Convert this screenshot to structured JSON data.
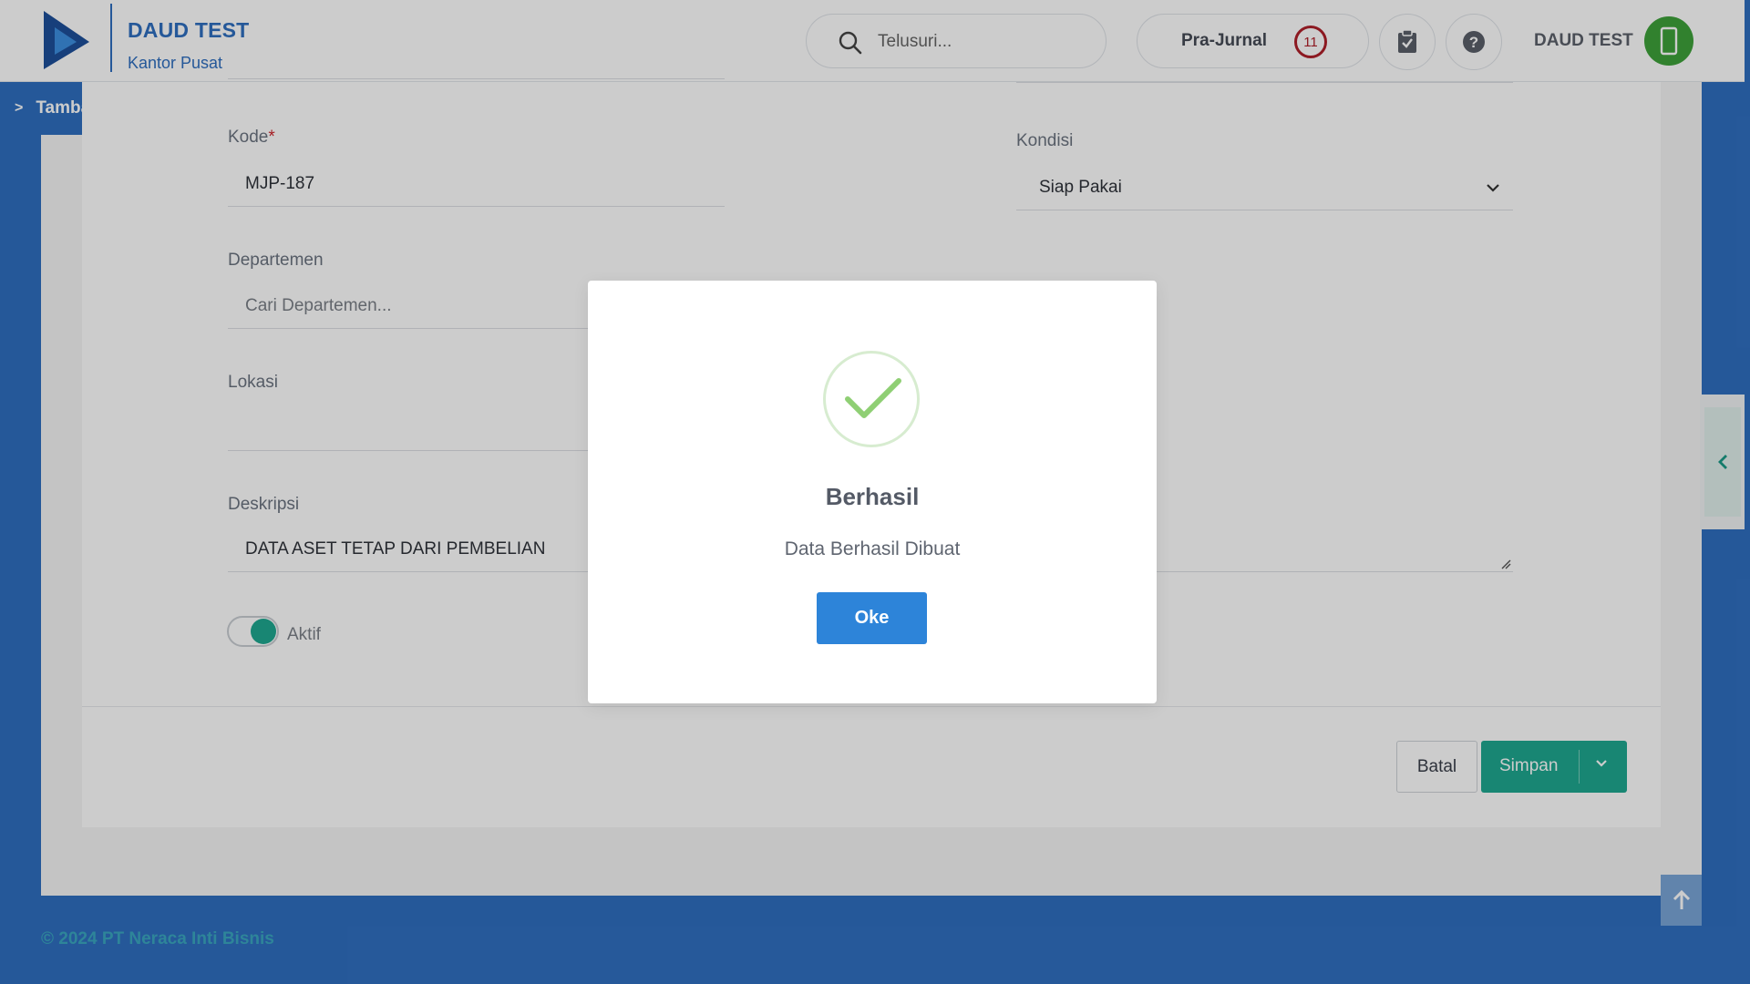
{
  "header": {
    "brand_title": "DAUD TEST",
    "brand_subtitle": "Kantor Pusat",
    "search_placeholder": "Telusuri...",
    "prajurnal_label": "Pra-Jurnal",
    "prajurnal_count": "11",
    "user_name": "DAUD TEST"
  },
  "breadcrumb": {
    "chevron": ">",
    "label": "Tambah Aset"
  },
  "form": {
    "kode_label": "Kode",
    "kode_required": "*",
    "kode_value": "MJP-187",
    "kondisi_label": "Kondisi",
    "kondisi_value": "Siap Pakai",
    "departemen_label": "Departemen",
    "departemen_placeholder": "Cari Departemen...",
    "lokasi_label": "Lokasi",
    "deskripsi_label": "Deskripsi",
    "deskripsi_value": "DATA ASET TETAP DARI PEMBELIAN",
    "aktif_label": "Aktif",
    "aktif_on": true
  },
  "actions": {
    "batal": "Batal",
    "simpan": "Simpan"
  },
  "footer": {
    "copyright": "© 2024 PT Neraca Inti Bisnis"
  },
  "modal": {
    "title": "Berhasil",
    "message": "Data Berhasil Dibuat",
    "button": "Oke"
  },
  "colors": {
    "primary": "#2f6fc0",
    "accent_green": "#1fa890",
    "modal_button": "#2d84d9",
    "badge_red": "#b0202a",
    "success_check": "#8fcf74"
  }
}
